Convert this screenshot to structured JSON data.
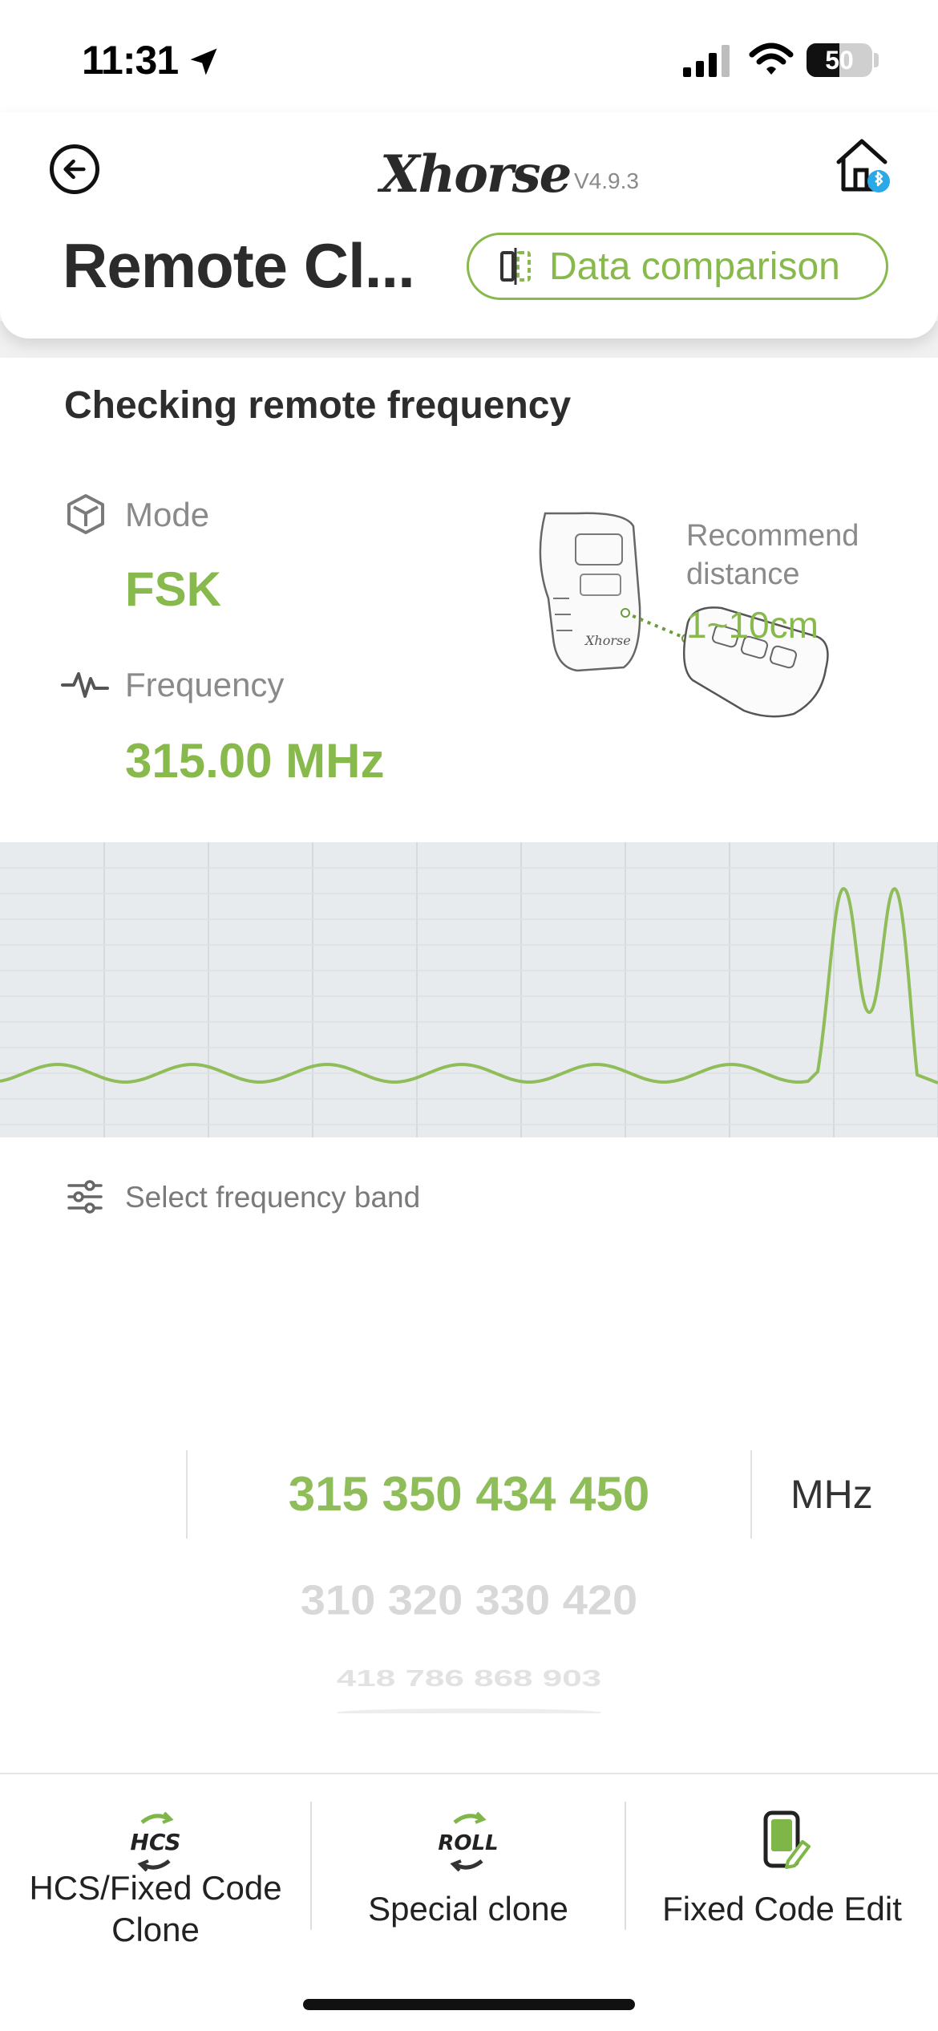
{
  "status_bar": {
    "time": "11:31",
    "battery": "50",
    "battery_fraction": 0.5
  },
  "header": {
    "logo": "Xhorse",
    "version": "V4.9.3",
    "title": "Remote Cl...",
    "compare_button": "Data comparison",
    "icons": {
      "back": "back-circle-arrow-icon",
      "home": "home-bluetooth-icon",
      "compare": "compare-icon"
    }
  },
  "check": {
    "title": "Checking remote frequency",
    "mode_label": "Mode",
    "mode_value": "FSK",
    "frequency_label": "Frequency",
    "frequency_value": "315.00 MHz",
    "recommend_label": "Recommend distance",
    "recommend_value": "1~10cm"
  },
  "band": {
    "label": "Select frequency band",
    "selected": "315 350 434 450",
    "unit": "MHz",
    "options": [
      "310 320 330 420",
      "418 786 868 903"
    ]
  },
  "tabs": [
    {
      "label": "HCS/Fixed Code Clone",
      "icon": "hcs-icon"
    },
    {
      "label": "Special clone",
      "icon": "roll-icon"
    },
    {
      "label": "Fixed Code Edit",
      "icon": "edit-phone-icon"
    }
  ],
  "colors": {
    "accent": "#88b94c",
    "wave": "#8fbd5a",
    "wave_bg": "#e8ebee"
  }
}
